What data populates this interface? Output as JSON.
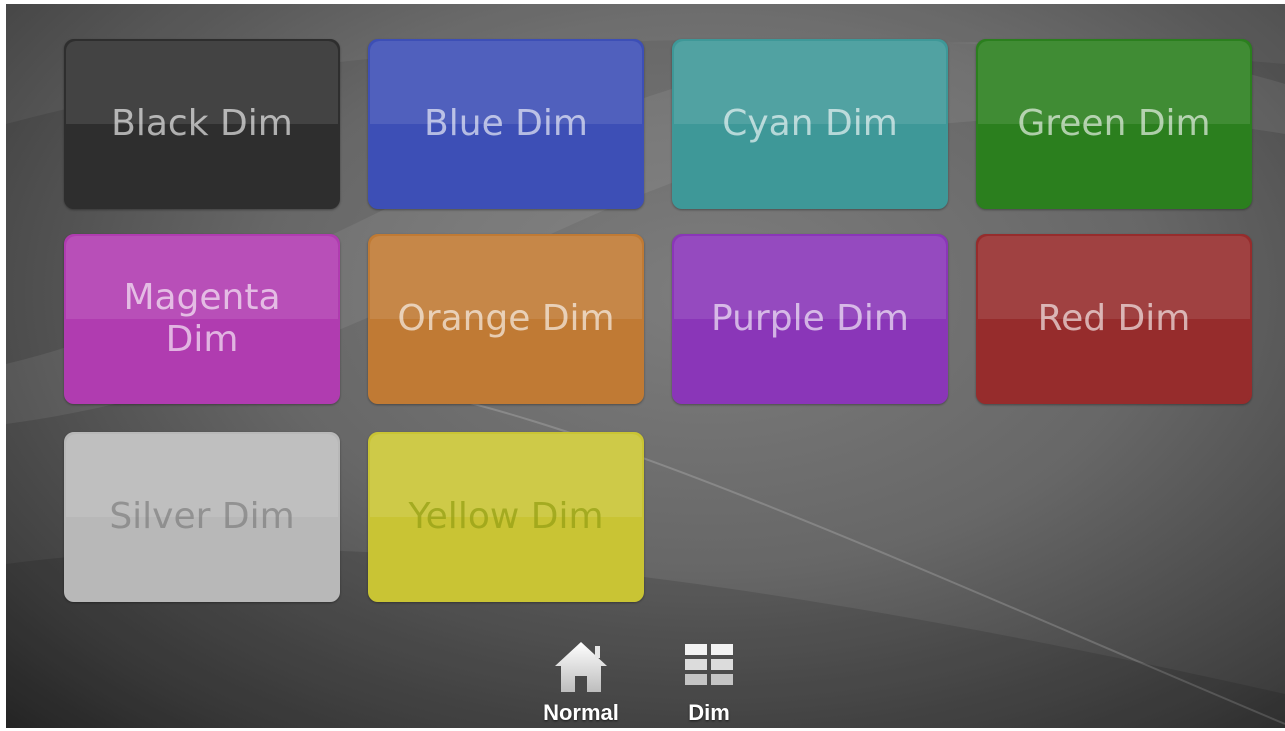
{
  "tiles": [
    {
      "label": "Black Dim",
      "color": "#2e2e2e"
    },
    {
      "label": "Blue Dim",
      "color": "#3d4fb6"
    },
    {
      "label": "Cyan Dim",
      "color": "#3e9898"
    },
    {
      "label": "Green Dim",
      "color": "#2b7f1e"
    },
    {
      "label": "Magenta Dim",
      "color": "#b03cb0"
    },
    {
      "label": "Orange Dim",
      "color": "#c07a34"
    },
    {
      "label": "Purple Dim",
      "color": "#8a36b8"
    },
    {
      "label": "Red Dim",
      "color": "#962c2c"
    },
    {
      "label": "Silver Dim",
      "color": "#b8b8b8"
    },
    {
      "label": "Yellow Dim",
      "color": "#c9c434"
    }
  ],
  "nav": {
    "normal": {
      "label": "Normal",
      "icon": "home-icon"
    },
    "dim": {
      "label": "Dim",
      "icon": "grid-icon"
    }
  }
}
